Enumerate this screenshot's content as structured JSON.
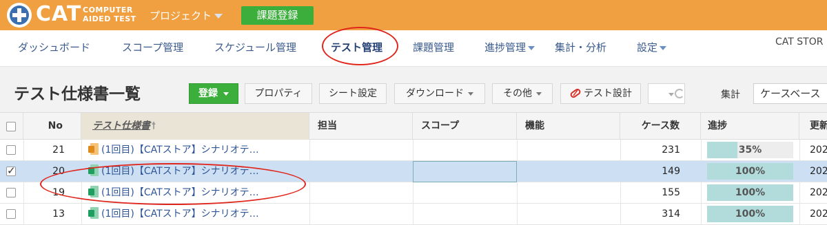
{
  "header": {
    "brand_main": "CAT",
    "brand_sub_line1": "COMPUTER",
    "brand_sub_line2": "AIDED TEST",
    "project_menu_label": "プロジェクト",
    "issue_register_label": "課題登録"
  },
  "nav": {
    "items": [
      {
        "label": "ダッシュボード"
      },
      {
        "label": "スコープ管理"
      },
      {
        "label": "スケジュール管理"
      },
      {
        "label": "テスト管理"
      },
      {
        "label": "課題管理"
      },
      {
        "label": "進捗管理"
      },
      {
        "label": "集計・分析"
      },
      {
        "label": "設定"
      }
    ],
    "active_item": "テスト管理",
    "store_label": "CAT STOR"
  },
  "toolbar": {
    "page_title": "テスト仕様書一覧",
    "register_label": "登録",
    "property_label": "プロパティ",
    "sheet_settings_label": "シート設定",
    "download_label": "ダウンロード",
    "other_label": "その他",
    "test_design_label": "テスト設計",
    "aggregate_label": "集計",
    "aggregate_value": "ケースベース"
  },
  "table": {
    "columns": {
      "no": "No",
      "spec": "テスト仕様書",
      "assignee": "担当",
      "scope": "スコープ",
      "function": "機能",
      "case_count": "ケース数",
      "progress": "進捗",
      "updated": "更新"
    },
    "rows": [
      {
        "no": "21",
        "name": "(1回目)【CATストア】シナリオテ…",
        "icon": "excel-orange-icon",
        "case_count": "231",
        "progress_pct": 35,
        "progress_label": "35%",
        "updated": "202",
        "checked": false,
        "selected": false
      },
      {
        "no": "20",
        "name": "(1回目)【CATストア】シナリオテ…",
        "icon": "excel-green-icon",
        "case_count": "149",
        "progress_pct": 100,
        "progress_label": "100%",
        "updated": "202",
        "checked": true,
        "selected": true
      },
      {
        "no": "19",
        "name": "(1回目)【CATストア】シナリオテ…",
        "icon": "excel-green-icon",
        "case_count": "155",
        "progress_pct": 100,
        "progress_label": "100%",
        "updated": "202",
        "checked": false,
        "selected": false
      },
      {
        "no": "13",
        "name": "(1回目)【CATストア】シナリオテ…",
        "icon": "excel-green-icon",
        "case_count": "314",
        "progress_pct": 100,
        "progress_label": "100%",
        "updated": "202",
        "checked": false,
        "selected": false
      }
    ]
  },
  "colors": {
    "header_bg": "#f0a040",
    "accent_green": "#3cae3c",
    "selected_row": "#cde0f3",
    "progress_fill": "#b2dcdc",
    "annotation_red": "#e0261c"
  }
}
